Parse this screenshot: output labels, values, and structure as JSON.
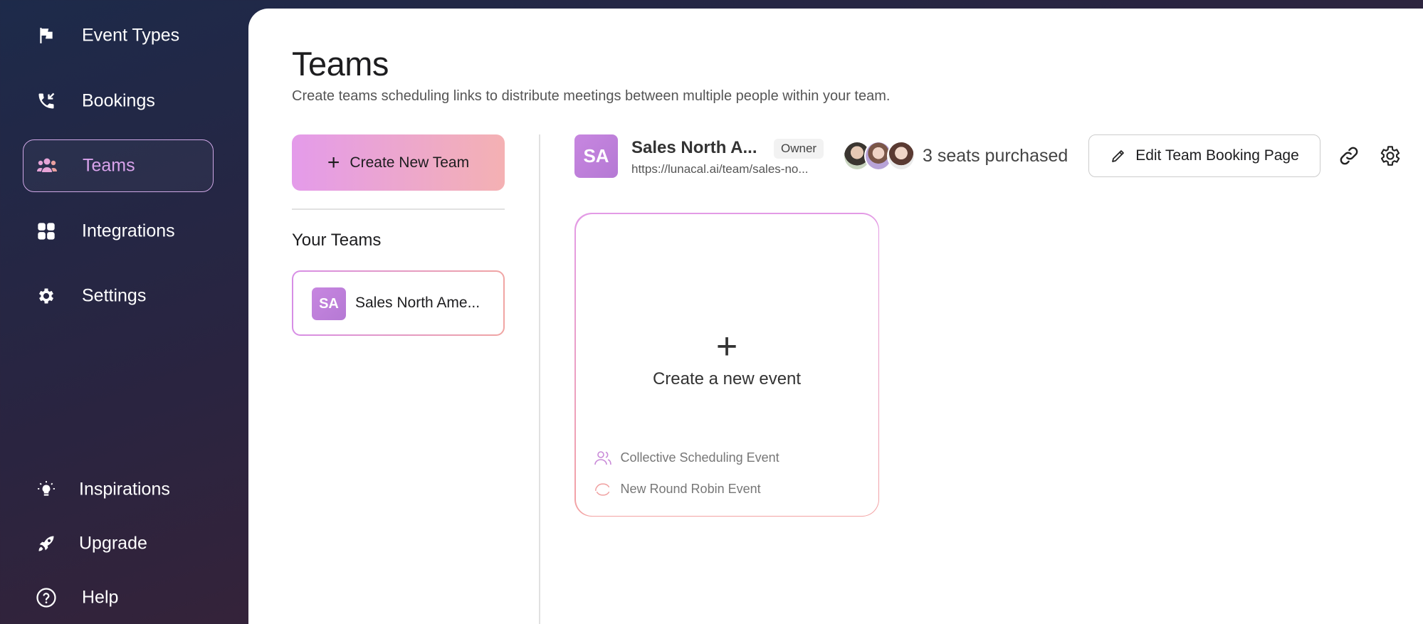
{
  "sidebar": {
    "items": [
      {
        "label": "Event Types",
        "icon": "flag-icon"
      },
      {
        "label": "Bookings",
        "icon": "phone-incoming-icon"
      },
      {
        "label": "Teams",
        "icon": "users-icon",
        "active": true
      },
      {
        "label": "Integrations",
        "icon": "grid-icon"
      },
      {
        "label": "Settings",
        "icon": "gear-icon"
      },
      {
        "label": "Inspirations",
        "icon": "lightbulb-icon"
      },
      {
        "label": "Upgrade",
        "icon": "rocket-icon"
      },
      {
        "label": "Help",
        "icon": "help-circle-icon"
      }
    ]
  },
  "page": {
    "title": "Teams",
    "subtitle": "Create teams scheduling links to distribute meetings between multiple people within your team."
  },
  "teams_panel": {
    "create_label": "Create New Team",
    "your_teams_heading": "Your Teams",
    "teams": [
      {
        "initials": "SA",
        "name": "Sales North Ame..."
      }
    ]
  },
  "team_header": {
    "initials": "SA",
    "name": "Sales North A...",
    "role": "Owner",
    "url": "https://lunacal.ai/team/sales-no...",
    "seats": "3 seats purchased",
    "edit_label": "Edit Team Booking Page"
  },
  "event_card": {
    "create_label": "Create a new event",
    "options": [
      {
        "label": "Collective Scheduling Event",
        "icon": "users-outline-icon"
      },
      {
        "label": "New Round Robin Event",
        "icon": "round-robin-icon"
      }
    ]
  },
  "colors": {
    "accent_start": "#e49bea",
    "accent_end": "#f4b1b3",
    "active_nav": "#d9a3ec",
    "avatar": "#c786e0"
  }
}
